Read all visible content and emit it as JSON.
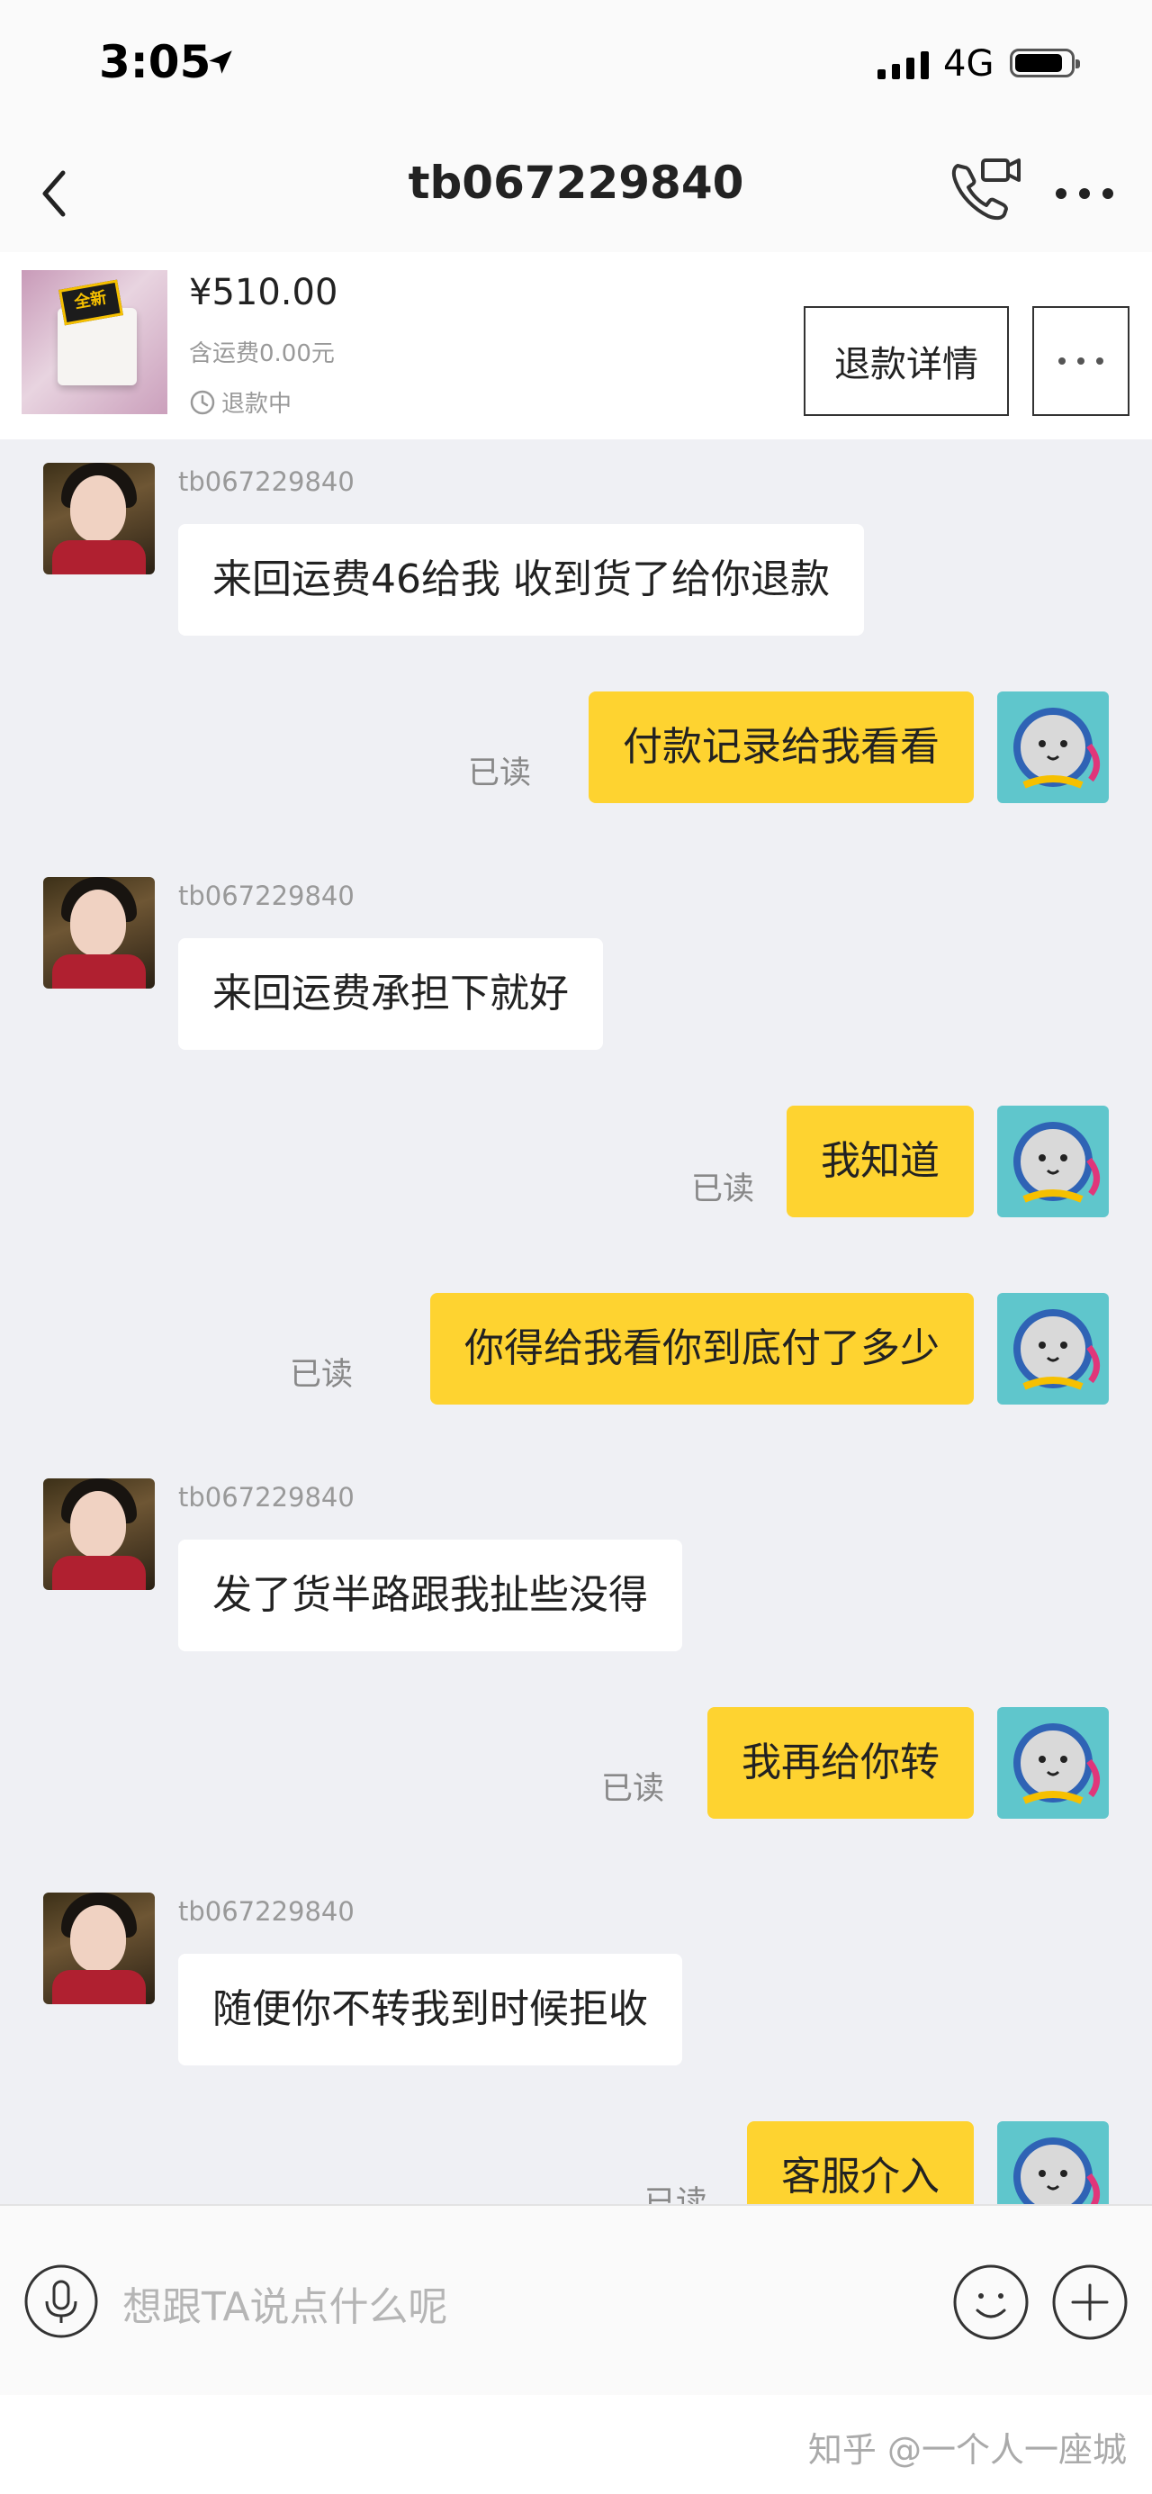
{
  "status_bar": {
    "time": "3:05",
    "network": "4G"
  },
  "nav": {
    "title": "tb067229840"
  },
  "product": {
    "thumb_tag": "全新",
    "price": "¥510.00",
    "shipping": "含运费0.00元",
    "status": "退款中",
    "detail_button": "退款详情"
  },
  "messages": [
    {
      "side": "in",
      "username": "tb067229840",
      "text": "来回运费46给我 收到货了给你退款"
    },
    {
      "side": "out",
      "read": "已读",
      "text": "付款记录给我看看"
    },
    {
      "side": "in",
      "username": "tb067229840",
      "text": "来回运费承担下就好"
    },
    {
      "side": "out",
      "read": "已读",
      "text": "我知道"
    },
    {
      "side": "out",
      "read": "已读",
      "text": "你得给我看你到底付了多少"
    },
    {
      "side": "in",
      "username": "tb067229840",
      "text": "发了货半路跟我扯些没得"
    },
    {
      "side": "out",
      "read": "已读",
      "text": "我再给你转"
    },
    {
      "side": "in",
      "username": "tb067229840",
      "text": "随便你不转我到时候拒收"
    },
    {
      "side": "out",
      "read": "已读",
      "text": "客服介入"
    }
  ],
  "input": {
    "placeholder": "想跟TA说点什么呢"
  },
  "footer": {
    "watermark": "知乎 @一个人一座城"
  },
  "colors": {
    "outgoing_bubble": "#fed330",
    "incoming_bubble": "#ffffff",
    "chat_background": "#eff0f4"
  }
}
